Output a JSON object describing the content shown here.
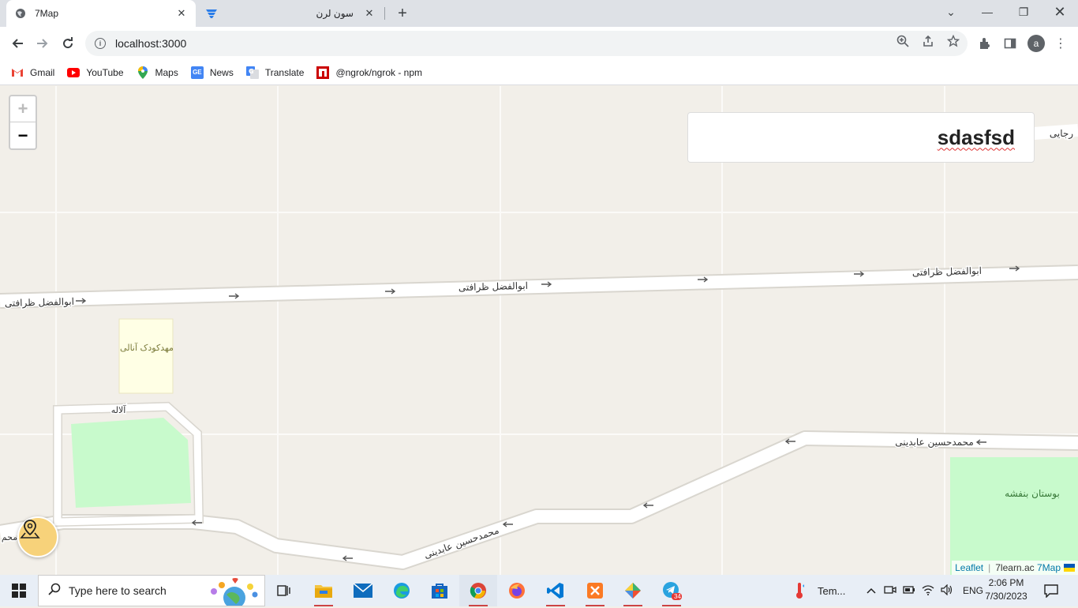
{
  "browser": {
    "tabs": [
      {
        "title": "7Map",
        "active": true,
        "icon": "globe-icon"
      },
      {
        "title": "سون لرن",
        "active": false,
        "icon": "7learn-logo-icon"
      }
    ],
    "url": "localhost:3000",
    "window_controls": [
      "chevron-down-icon",
      "minimize-icon",
      "restore-icon",
      "close-icon"
    ]
  },
  "bookmarks": [
    {
      "label": "Gmail",
      "icon": "gmail-icon",
      "color": "#ea4335"
    },
    {
      "label": "YouTube",
      "icon": "youtube-icon",
      "color": "#ff0000"
    },
    {
      "label": "Maps",
      "icon": "maps-icon",
      "color": "#34a853"
    },
    {
      "label": "News",
      "icon": "news-icon",
      "color": "#4285f4"
    },
    {
      "label": "Translate",
      "icon": "translate-icon",
      "color": "#4285f4"
    },
    {
      "label": "@ngrok/ngrok - npm",
      "icon": "npm-icon",
      "color": "#cb0000"
    }
  ],
  "map": {
    "info_text": "sdasfsd",
    "zoom_in": "+",
    "zoom_out": "−",
    "labels": {
      "street1": "ابوالفضل ظرافتی",
      "street2": "محمدحسین عابدینی",
      "street3": "رجایی",
      "kindergarten": "مهدکودک آنالی",
      "alley": "آلاله",
      "park": "بوستان بنفشه",
      "partial": "محم"
    },
    "attribution": {
      "leaflet": "Leaflet",
      "separator": "|",
      "site": "7learn.ac",
      "brand": "7Map"
    }
  },
  "taskbar": {
    "search_placeholder": "Type here to search",
    "weather": "Tem...",
    "language": "ENG",
    "time": "2:06 PM",
    "date": "7/30/2023",
    "telegram_badge": "34"
  }
}
